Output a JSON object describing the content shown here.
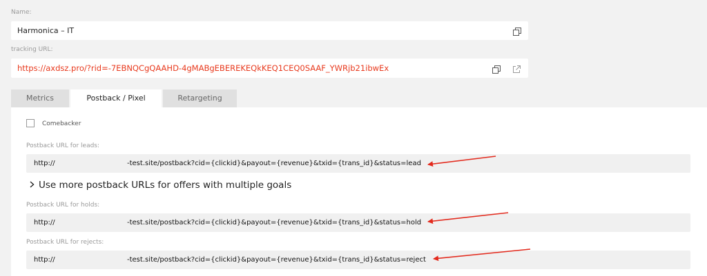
{
  "name": {
    "label": "Name:",
    "value": "Harmonica – IT"
  },
  "tracking": {
    "label": "tracking URL:",
    "value": "https://axdsz.pro/?rid=-7EBNQCgQAAHD-4gMABgEBEREKEQkKEQ1CEQ0SAAF_YWRjb21ibwEx",
    "color": "#e8391d"
  },
  "tabs": [
    {
      "label": "Metrics"
    },
    {
      "label": "Postback / Pixel"
    },
    {
      "label": "Retargeting"
    }
  ],
  "postback": {
    "comebacker_label": "Comebacker",
    "leads": {
      "label": "Postback URL for leads:",
      "protocol": "http://",
      "rest": "-test.site/postback?cid={clickid}&payout={revenue}&txid={trans_id}&status=lead"
    },
    "more_goals": "Use more postback URLs for offers with multiple goals",
    "holds": {
      "label": "Postback URL for holds:",
      "protocol": "http://",
      "rest": "-test.site/postback?cid={clickid}&payout={revenue}&txid={trans_id}&status=hold"
    },
    "rejects": {
      "label": "Postback URL for rejects:",
      "protocol": "http://",
      "rest": "-test.site/postback?cid={clickid}&payout={revenue}&txid={trans_id}&status=reject"
    }
  },
  "icons": {
    "copy": "copy-icon",
    "external": "external-link-icon",
    "arrow": "red-arrow-annotation"
  },
  "colors": {
    "annotation": "#e32a1d",
    "link": "#e8391d"
  }
}
